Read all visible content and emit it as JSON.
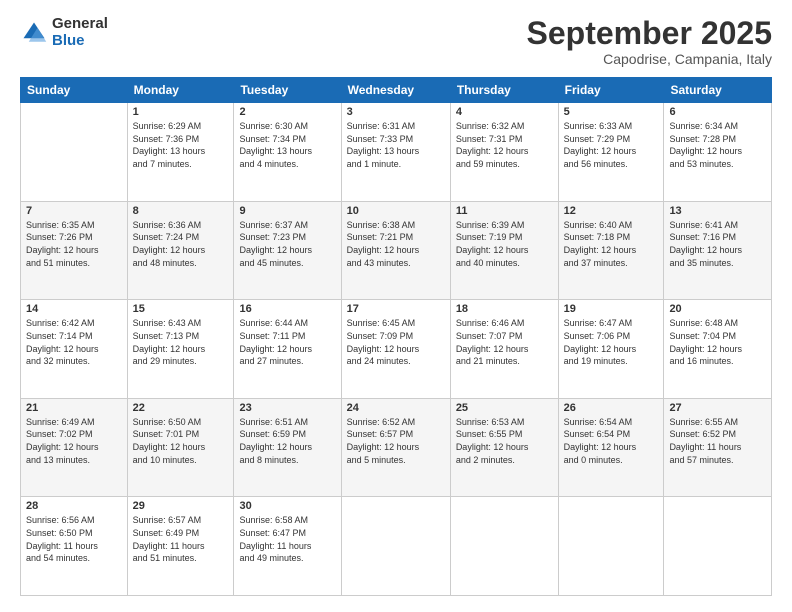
{
  "header": {
    "logo_general": "General",
    "logo_blue": "Blue",
    "month_title": "September 2025",
    "location": "Capodrise, Campania, Italy"
  },
  "weekdays": [
    "Sunday",
    "Monday",
    "Tuesday",
    "Wednesday",
    "Thursday",
    "Friday",
    "Saturday"
  ],
  "weeks": [
    [
      {
        "day": "",
        "info": ""
      },
      {
        "day": "1",
        "info": "Sunrise: 6:29 AM\nSunset: 7:36 PM\nDaylight: 13 hours\nand 7 minutes."
      },
      {
        "day": "2",
        "info": "Sunrise: 6:30 AM\nSunset: 7:34 PM\nDaylight: 13 hours\nand 4 minutes."
      },
      {
        "day": "3",
        "info": "Sunrise: 6:31 AM\nSunset: 7:33 PM\nDaylight: 13 hours\nand 1 minute."
      },
      {
        "day": "4",
        "info": "Sunrise: 6:32 AM\nSunset: 7:31 PM\nDaylight: 12 hours\nand 59 minutes."
      },
      {
        "day": "5",
        "info": "Sunrise: 6:33 AM\nSunset: 7:29 PM\nDaylight: 12 hours\nand 56 minutes."
      },
      {
        "day": "6",
        "info": "Sunrise: 6:34 AM\nSunset: 7:28 PM\nDaylight: 12 hours\nand 53 minutes."
      }
    ],
    [
      {
        "day": "7",
        "info": "Sunrise: 6:35 AM\nSunset: 7:26 PM\nDaylight: 12 hours\nand 51 minutes."
      },
      {
        "day": "8",
        "info": "Sunrise: 6:36 AM\nSunset: 7:24 PM\nDaylight: 12 hours\nand 48 minutes."
      },
      {
        "day": "9",
        "info": "Sunrise: 6:37 AM\nSunset: 7:23 PM\nDaylight: 12 hours\nand 45 minutes."
      },
      {
        "day": "10",
        "info": "Sunrise: 6:38 AM\nSunset: 7:21 PM\nDaylight: 12 hours\nand 43 minutes."
      },
      {
        "day": "11",
        "info": "Sunrise: 6:39 AM\nSunset: 7:19 PM\nDaylight: 12 hours\nand 40 minutes."
      },
      {
        "day": "12",
        "info": "Sunrise: 6:40 AM\nSunset: 7:18 PM\nDaylight: 12 hours\nand 37 minutes."
      },
      {
        "day": "13",
        "info": "Sunrise: 6:41 AM\nSunset: 7:16 PM\nDaylight: 12 hours\nand 35 minutes."
      }
    ],
    [
      {
        "day": "14",
        "info": "Sunrise: 6:42 AM\nSunset: 7:14 PM\nDaylight: 12 hours\nand 32 minutes."
      },
      {
        "day": "15",
        "info": "Sunrise: 6:43 AM\nSunset: 7:13 PM\nDaylight: 12 hours\nand 29 minutes."
      },
      {
        "day": "16",
        "info": "Sunrise: 6:44 AM\nSunset: 7:11 PM\nDaylight: 12 hours\nand 27 minutes."
      },
      {
        "day": "17",
        "info": "Sunrise: 6:45 AM\nSunset: 7:09 PM\nDaylight: 12 hours\nand 24 minutes."
      },
      {
        "day": "18",
        "info": "Sunrise: 6:46 AM\nSunset: 7:07 PM\nDaylight: 12 hours\nand 21 minutes."
      },
      {
        "day": "19",
        "info": "Sunrise: 6:47 AM\nSunset: 7:06 PM\nDaylight: 12 hours\nand 19 minutes."
      },
      {
        "day": "20",
        "info": "Sunrise: 6:48 AM\nSunset: 7:04 PM\nDaylight: 12 hours\nand 16 minutes."
      }
    ],
    [
      {
        "day": "21",
        "info": "Sunrise: 6:49 AM\nSunset: 7:02 PM\nDaylight: 12 hours\nand 13 minutes."
      },
      {
        "day": "22",
        "info": "Sunrise: 6:50 AM\nSunset: 7:01 PM\nDaylight: 12 hours\nand 10 minutes."
      },
      {
        "day": "23",
        "info": "Sunrise: 6:51 AM\nSunset: 6:59 PM\nDaylight: 12 hours\nand 8 minutes."
      },
      {
        "day": "24",
        "info": "Sunrise: 6:52 AM\nSunset: 6:57 PM\nDaylight: 12 hours\nand 5 minutes."
      },
      {
        "day": "25",
        "info": "Sunrise: 6:53 AM\nSunset: 6:55 PM\nDaylight: 12 hours\nand 2 minutes."
      },
      {
        "day": "26",
        "info": "Sunrise: 6:54 AM\nSunset: 6:54 PM\nDaylight: 12 hours\nand 0 minutes."
      },
      {
        "day": "27",
        "info": "Sunrise: 6:55 AM\nSunset: 6:52 PM\nDaylight: 11 hours\nand 57 minutes."
      }
    ],
    [
      {
        "day": "28",
        "info": "Sunrise: 6:56 AM\nSunset: 6:50 PM\nDaylight: 11 hours\nand 54 minutes."
      },
      {
        "day": "29",
        "info": "Sunrise: 6:57 AM\nSunset: 6:49 PM\nDaylight: 11 hours\nand 51 minutes."
      },
      {
        "day": "30",
        "info": "Sunrise: 6:58 AM\nSunset: 6:47 PM\nDaylight: 11 hours\nand 49 minutes."
      },
      {
        "day": "",
        "info": ""
      },
      {
        "day": "",
        "info": ""
      },
      {
        "day": "",
        "info": ""
      },
      {
        "day": "",
        "info": ""
      }
    ]
  ]
}
